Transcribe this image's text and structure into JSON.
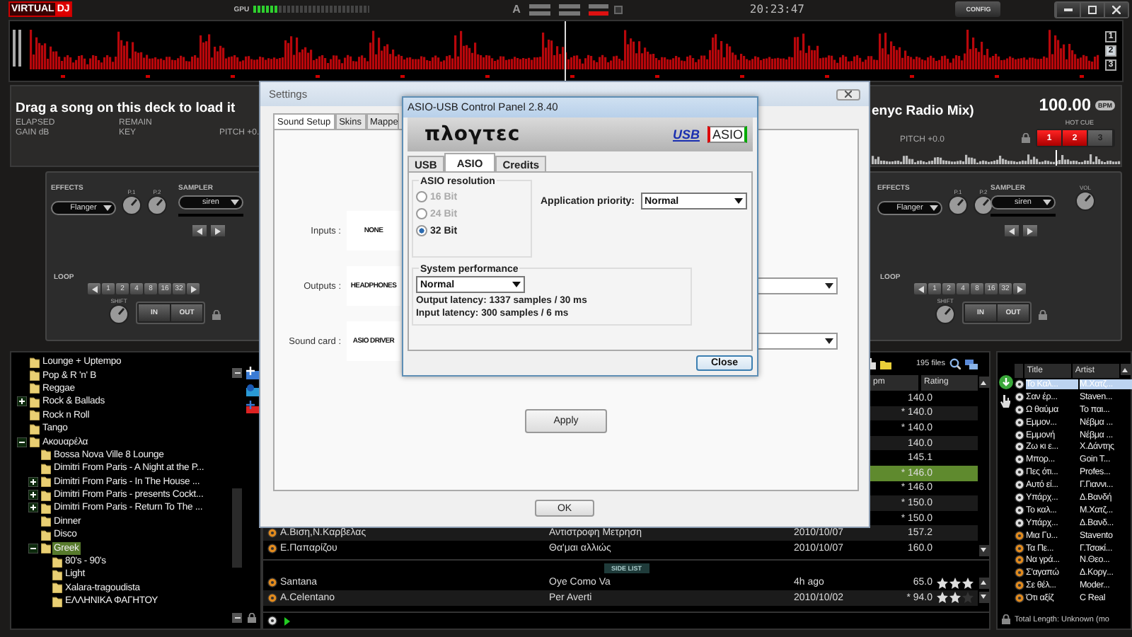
{
  "topbar": {
    "logo": [
      "VIRTUAL",
      "DJ"
    ],
    "gpu": {
      "label": "GPU",
      "level": 0.2
    },
    "font_button": "A",
    "clock": "20:23:47",
    "config": "CONFIG"
  },
  "waveform": {
    "decks": [
      {
        "label": "1",
        "selected": false
      },
      {
        "label": "2",
        "selected": true
      },
      {
        "label": "3",
        "selected": false
      }
    ]
  },
  "left_deck": {
    "message": "Drag a song on this deck to load it",
    "info": [
      [
        "ELAPSED",
        "REMAIN"
      ],
      [
        "GAIN dB",
        "KEY",
        "PITCH +0."
      ]
    ]
  },
  "right_deck": {
    "title": "enyc Radio Mix)",
    "bpm": "100.00",
    "bpm_unit": "BPM",
    "hot_cue_label": "HOT CUE",
    "hot_cues": [
      {
        "label": "1",
        "on": true
      },
      {
        "label": "2",
        "on": true
      },
      {
        "label": "3",
        "on": false
      }
    ],
    "pitch": "PITCH +0.0"
  },
  "left_controls": {
    "effects_label": "EFFECTS",
    "effect": "Flanger",
    "knobs": [
      "P.1",
      "P.2"
    ],
    "sampler_label": "SAMPLER",
    "sample": "siren",
    "loop_label": "LOOP",
    "loop_sizes": [
      "1",
      "2",
      "4",
      "8",
      "16",
      "32"
    ],
    "shift": "SHIFT",
    "loop_in": "IN",
    "loop_out": "OUT"
  },
  "right_controls": {
    "effects_label": "EFFECTS",
    "effect": "Flanger",
    "knobs": [
      "P.1",
      "P.2"
    ],
    "sampler_label": "SAMPLER",
    "sample": "siren",
    "volume_label": "VOL",
    "loop_label": "LOOP",
    "loop_sizes": [
      "1",
      "2",
      "4",
      "8",
      "16",
      "32"
    ],
    "shift": "SHIFT",
    "loop_in": "IN",
    "loop_out": "OUT"
  },
  "folders": [
    {
      "label": "Lounge + Uptempo",
      "kind": "folder",
      "selected": false
    },
    {
      "label": "Pop & R 'n' B",
      "kind": "folder",
      "selected": false
    },
    {
      "label": "Reggae",
      "kind": "folder",
      "selected": false
    },
    {
      "label": "Rock & Ballads",
      "kind": "expandable",
      "expanded": false,
      "selected": false
    },
    {
      "label": "Rock n Roll",
      "kind": "folder",
      "selected": false
    },
    {
      "label": "Tango",
      "kind": "folder",
      "selected": false
    },
    {
      "label": "Ακουαρέλα",
      "kind": "expandable",
      "expanded": true,
      "selected": false,
      "children": [
        {
          "label": "Bossa Nova Ville 8 Lounge",
          "kind": "folder",
          "selected": false
        },
        {
          "label": "Dimitri From Paris - A Night at the P...",
          "kind": "folder",
          "selected": false
        },
        {
          "label": "Dimitri From Paris - In The House ...",
          "kind": "expandable",
          "expanded": false,
          "selected": false
        },
        {
          "label": "Dimitri From Paris - presents Cockt...",
          "kind": "expandable",
          "expanded": false,
          "selected": false
        },
        {
          "label": "Dimitri From Paris - Return To The ...",
          "kind": "expandable",
          "expanded": false,
          "selected": false
        },
        {
          "label": "Dinner",
          "kind": "folder",
          "selected": false
        },
        {
          "label": "Disco",
          "kind": "folder",
          "selected": false
        },
        {
          "label": "Greek",
          "kind": "expandable",
          "expanded": true,
          "selected": true,
          "children": [
            {
              "label": "80's - 90's",
              "kind": "folder",
              "selected": false
            },
            {
              "label": "Light",
              "kind": "folder",
              "selected": false
            },
            {
              "label": "Xalara-tragoudista",
              "kind": "folder",
              "selected": false
            },
            {
              "label": "ΕΛΛΗΝΙΚΑ ΦΑΓΗΤΟΥ",
              "kind": "folder",
              "selected": false
            }
          ]
        }
      ]
    }
  ],
  "file_list": {
    "count": "195 files",
    "columns": [
      "pm",
      "Rating"
    ],
    "rows": [
      {
        "bpm": "140.0",
        "selected": false
      },
      {
        "bpm": "* 140.0",
        "selected": false
      },
      {
        "bpm": "* 140.0",
        "selected": false
      },
      {
        "bpm": "140.0",
        "selected": false
      },
      {
        "bpm": "145.1",
        "selected": false
      },
      {
        "bpm": "* 146.0",
        "selected": true
      },
      {
        "bpm": "* 146.0",
        "selected": false
      },
      {
        "bpm": "* 150.0",
        "selected": false
      },
      {
        "bpm": "* 150.0",
        "selected": false
      },
      {
        "artist": "Α.Βιση,Ν.Καρβελας",
        "title": "Αντιστροφη Μετρηση",
        "date": "2010/10/07",
        "bpm": "157.2",
        "selected": false
      },
      {
        "artist": "Ε.Παπαρίζου",
        "title": "Θα'μαι αλλιώς",
        "date": "2010/10/07",
        "bpm": "160.0",
        "selected": false
      }
    ]
  },
  "side_list": {
    "label": "SIDE LIST",
    "rows": [
      {
        "artist": "Santana",
        "title": "Oye Como Va",
        "date": "4h ago",
        "bpm": "65.0",
        "stars": 3
      },
      {
        "artist": "A.Celentano",
        "title": "Per Averti",
        "date": "2010/10/02",
        "bpm": "* 94.0",
        "stars": 2
      }
    ]
  },
  "playlist": {
    "columns": [
      "Title",
      "Artist"
    ],
    "rows": [
      {
        "title": "Το Καλ...",
        "artist": "Μ.Χατζ...",
        "played": true,
        "selected": true
      },
      {
        "title": "Σαν έρ...",
        "artist": "Staven...",
        "played": true,
        "selected": false
      },
      {
        "title": "Ω θαύμα",
        "artist": "Το παι...",
        "played": true,
        "selected": false
      },
      {
        "title": "Εμμον...",
        "artist": "Νέβμα ...",
        "played": true,
        "selected": false
      },
      {
        "title": "Εμμονή",
        "artist": "Νέβμα ...",
        "played": true,
        "selected": false
      },
      {
        "title": "Ζω κι ε...",
        "artist": "Χ.Δάντης",
        "played": true,
        "selected": false
      },
      {
        "title": "Μπορ...",
        "artist": "Goin T...",
        "played": true,
        "selected": false
      },
      {
        "title": "Πες ότι...",
        "artist": "Profes...",
        "played": true,
        "selected": false
      },
      {
        "title": "Αυτό εί...",
        "artist": "Γ.Γιαννι...",
        "played": true,
        "selected": false
      },
      {
        "title": "Υπάρχ...",
        "artist": "Δ.Βανδή",
        "played": true,
        "selected": false
      },
      {
        "title": "Το καλ...",
        "artist": "Μ.Χατζ...",
        "played": true,
        "selected": false
      },
      {
        "title": "Υπάρχ...",
        "artist": "Δ.Βανδ...",
        "played": true,
        "selected": false
      },
      {
        "title": "Μια Γυ...",
        "artist": "Stavento",
        "played": false,
        "selected": false
      },
      {
        "title": "Τα Πε...",
        "artist": "Γ.Τσακί...",
        "played": false,
        "selected": false
      },
      {
        "title": "Να γρά...",
        "artist": "Ν.Θεο...",
        "played": false,
        "selected": false
      },
      {
        "title": "Σ'αγαπώ",
        "artist": "Δ.Κοργ...",
        "played": false,
        "selected": false
      },
      {
        "title": "Σε θέλ...",
        "artist": "Moder...",
        "played": false,
        "selected": false
      },
      {
        "title": "Ότι αξίζ",
        "artist": "C Real",
        "played": false,
        "selected": false
      }
    ],
    "total": "Total Length: Unknown (mo"
  },
  "settings": {
    "title": "Settings",
    "tabs": [
      {
        "label": "Sound Setup",
        "selected": true
      },
      {
        "label": "Skins",
        "selected": false
      },
      {
        "label": "Mappe",
        "selected": false
      }
    ],
    "fields": [
      {
        "label": "Inputs :",
        "value": "NONE",
        "dropdown": false
      },
      {
        "label": "Outputs :",
        "value": "HEADPHONES",
        "dropdown": true
      },
      {
        "label": "Sound card :",
        "value": "ASIO DRIVER",
        "dropdown": true
      }
    ],
    "apply": "Apply",
    "ok": "OK"
  },
  "asio": {
    "title": "ASIO-USB Control Panel 2.8.40",
    "brand": "πλογτεc",
    "usb_logo": "USB",
    "asio_logo": "ASIO",
    "tabs": [
      {
        "label": "USB",
        "selected": false
      },
      {
        "label": "ASIO",
        "selected": true
      },
      {
        "label": "Credits",
        "selected": false
      }
    ],
    "resolution": {
      "title": "ASIO resolution",
      "options": [
        {
          "label": "16 Bit",
          "selected": false,
          "disabled": true
        },
        {
          "label": "24 Bit",
          "selected": false,
          "disabled": true
        },
        {
          "label": "32 Bit",
          "selected": true,
          "disabled": false
        }
      ]
    },
    "priority": {
      "label": "Application priority:",
      "value": "Normal"
    },
    "performance": {
      "title": "System performance",
      "value": "Normal",
      "lines": [
        "Output latency: 1337 samples / 30 ms",
        "Input latency: 300 samples / 6 ms"
      ]
    },
    "close": "Close"
  }
}
